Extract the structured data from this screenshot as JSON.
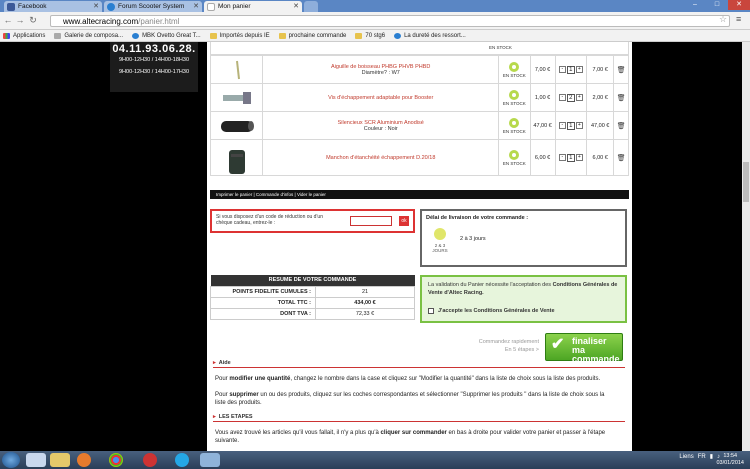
{
  "browser": {
    "tabs": [
      {
        "label": "Facebook",
        "color": "#3b5998"
      },
      {
        "label": "Forum Scooter System",
        "color": "#2a7fd1"
      },
      {
        "label": "Mon panier",
        "color": "#ffffff"
      }
    ],
    "window_controls": {
      "min": "–",
      "max": "□",
      "close": "✕"
    },
    "url_domain": "www.altecracing.com",
    "url_path": "/panier.html",
    "bookmarks": [
      "Applications",
      "Galerie de composa...",
      "MBK Ovetto Great T...",
      "Importés depuis IE",
      "prochaine commande",
      "70 stg6",
      "La dureté des ressort..."
    ]
  },
  "contact": {
    "phone": "04.11.93.06.28.",
    "hours_1": "9H00-12H30 / 14H00-18H30",
    "hours_2": "9H00-12H30 / 14H00-17H30"
  },
  "cart": {
    "stock_label": "EN STOCK",
    "items": [
      {
        "name": "Aiguille de boisseau PHBG PHVB PHBD",
        "attr": "Diamètre? : W7",
        "price": "7,00 €",
        "qty": "1",
        "total": "7,00 €"
      },
      {
        "name": "Vis d'échappement adaptable pour Booster",
        "attr": "",
        "price": "1,00 €",
        "qty": "2",
        "total": "2,00 €"
      },
      {
        "name": "Silencieux SCR Aluminium Anodisé",
        "attr": "Couleur : Noir",
        "price": "47,00 €",
        "qty": "1",
        "total": "47,00 €"
      },
      {
        "name": "Manchon d'étanchéité échappement D.20/18",
        "attr": "",
        "price": "6,00 €",
        "qty": "1",
        "total": "6,00 €"
      }
    ],
    "footer_links": "Imprimer le panier | Commande d'infos | Vider le panier"
  },
  "coupon": {
    "text": "Si vous disposez d'un code de réduction ou d'un chèque cadeau, entrez-le :",
    "button": "ok"
  },
  "delivery": {
    "title": "Délai de livraison de votre commande :",
    "icon_label": "2 & 3 JOURS",
    "value": "2 à 3 jours"
  },
  "summary": {
    "header": "RESUME DE VOTRE COMMANDE",
    "rows": [
      {
        "label": "POINTS FIDELITE CUMULES :",
        "value": "21"
      },
      {
        "label": "TOTAL TTC :",
        "value": "434,00 €"
      },
      {
        "label": "DONT TVA :",
        "value": "72,33 €"
      }
    ]
  },
  "cgv": {
    "text_1": "La validation du Panier nécessite l'acceptation des ",
    "text_bold": "Conditions Générales de Vente d'Altec Racing.",
    "checkbox_label": "J'accepte les Conditions Générales de Vente"
  },
  "quick_order": {
    "line1": "Commandez rapidement",
    "line2": "En 5 étapes >"
  },
  "finalize": {
    "line1": "finaliser",
    "line2": "ma commande"
  },
  "help": {
    "title": "Aide",
    "p1_a": "Pour ",
    "p1_b": "modifier une quantité",
    "p1_c": ", changez le nombre dans la case et cliquez sur \"Modifier la quantité\" dans la liste de choix sous la liste des produits.",
    "p2_a": "Pour ",
    "p2_b": "supprimer",
    "p2_c": " un ou des produits, cliquez sur les coches correspondantes et sélectionner \"Supprimer les produits \" dans la liste de choix sous la liste des produits."
  },
  "steps": {
    "title": "LES ETAPES",
    "p_a": "Vous avez trouvé les articles qu'il vous fallait, il n'y a plus qu'à ",
    "p_b": "cliquer sur commander",
    "p_c": " en bas à droite pour valider votre panier et passer à l'étape suivante."
  },
  "taskbar": {
    "links": "Liens",
    "lang": "FR",
    "time": "13:54",
    "date": "03/01/2014"
  }
}
